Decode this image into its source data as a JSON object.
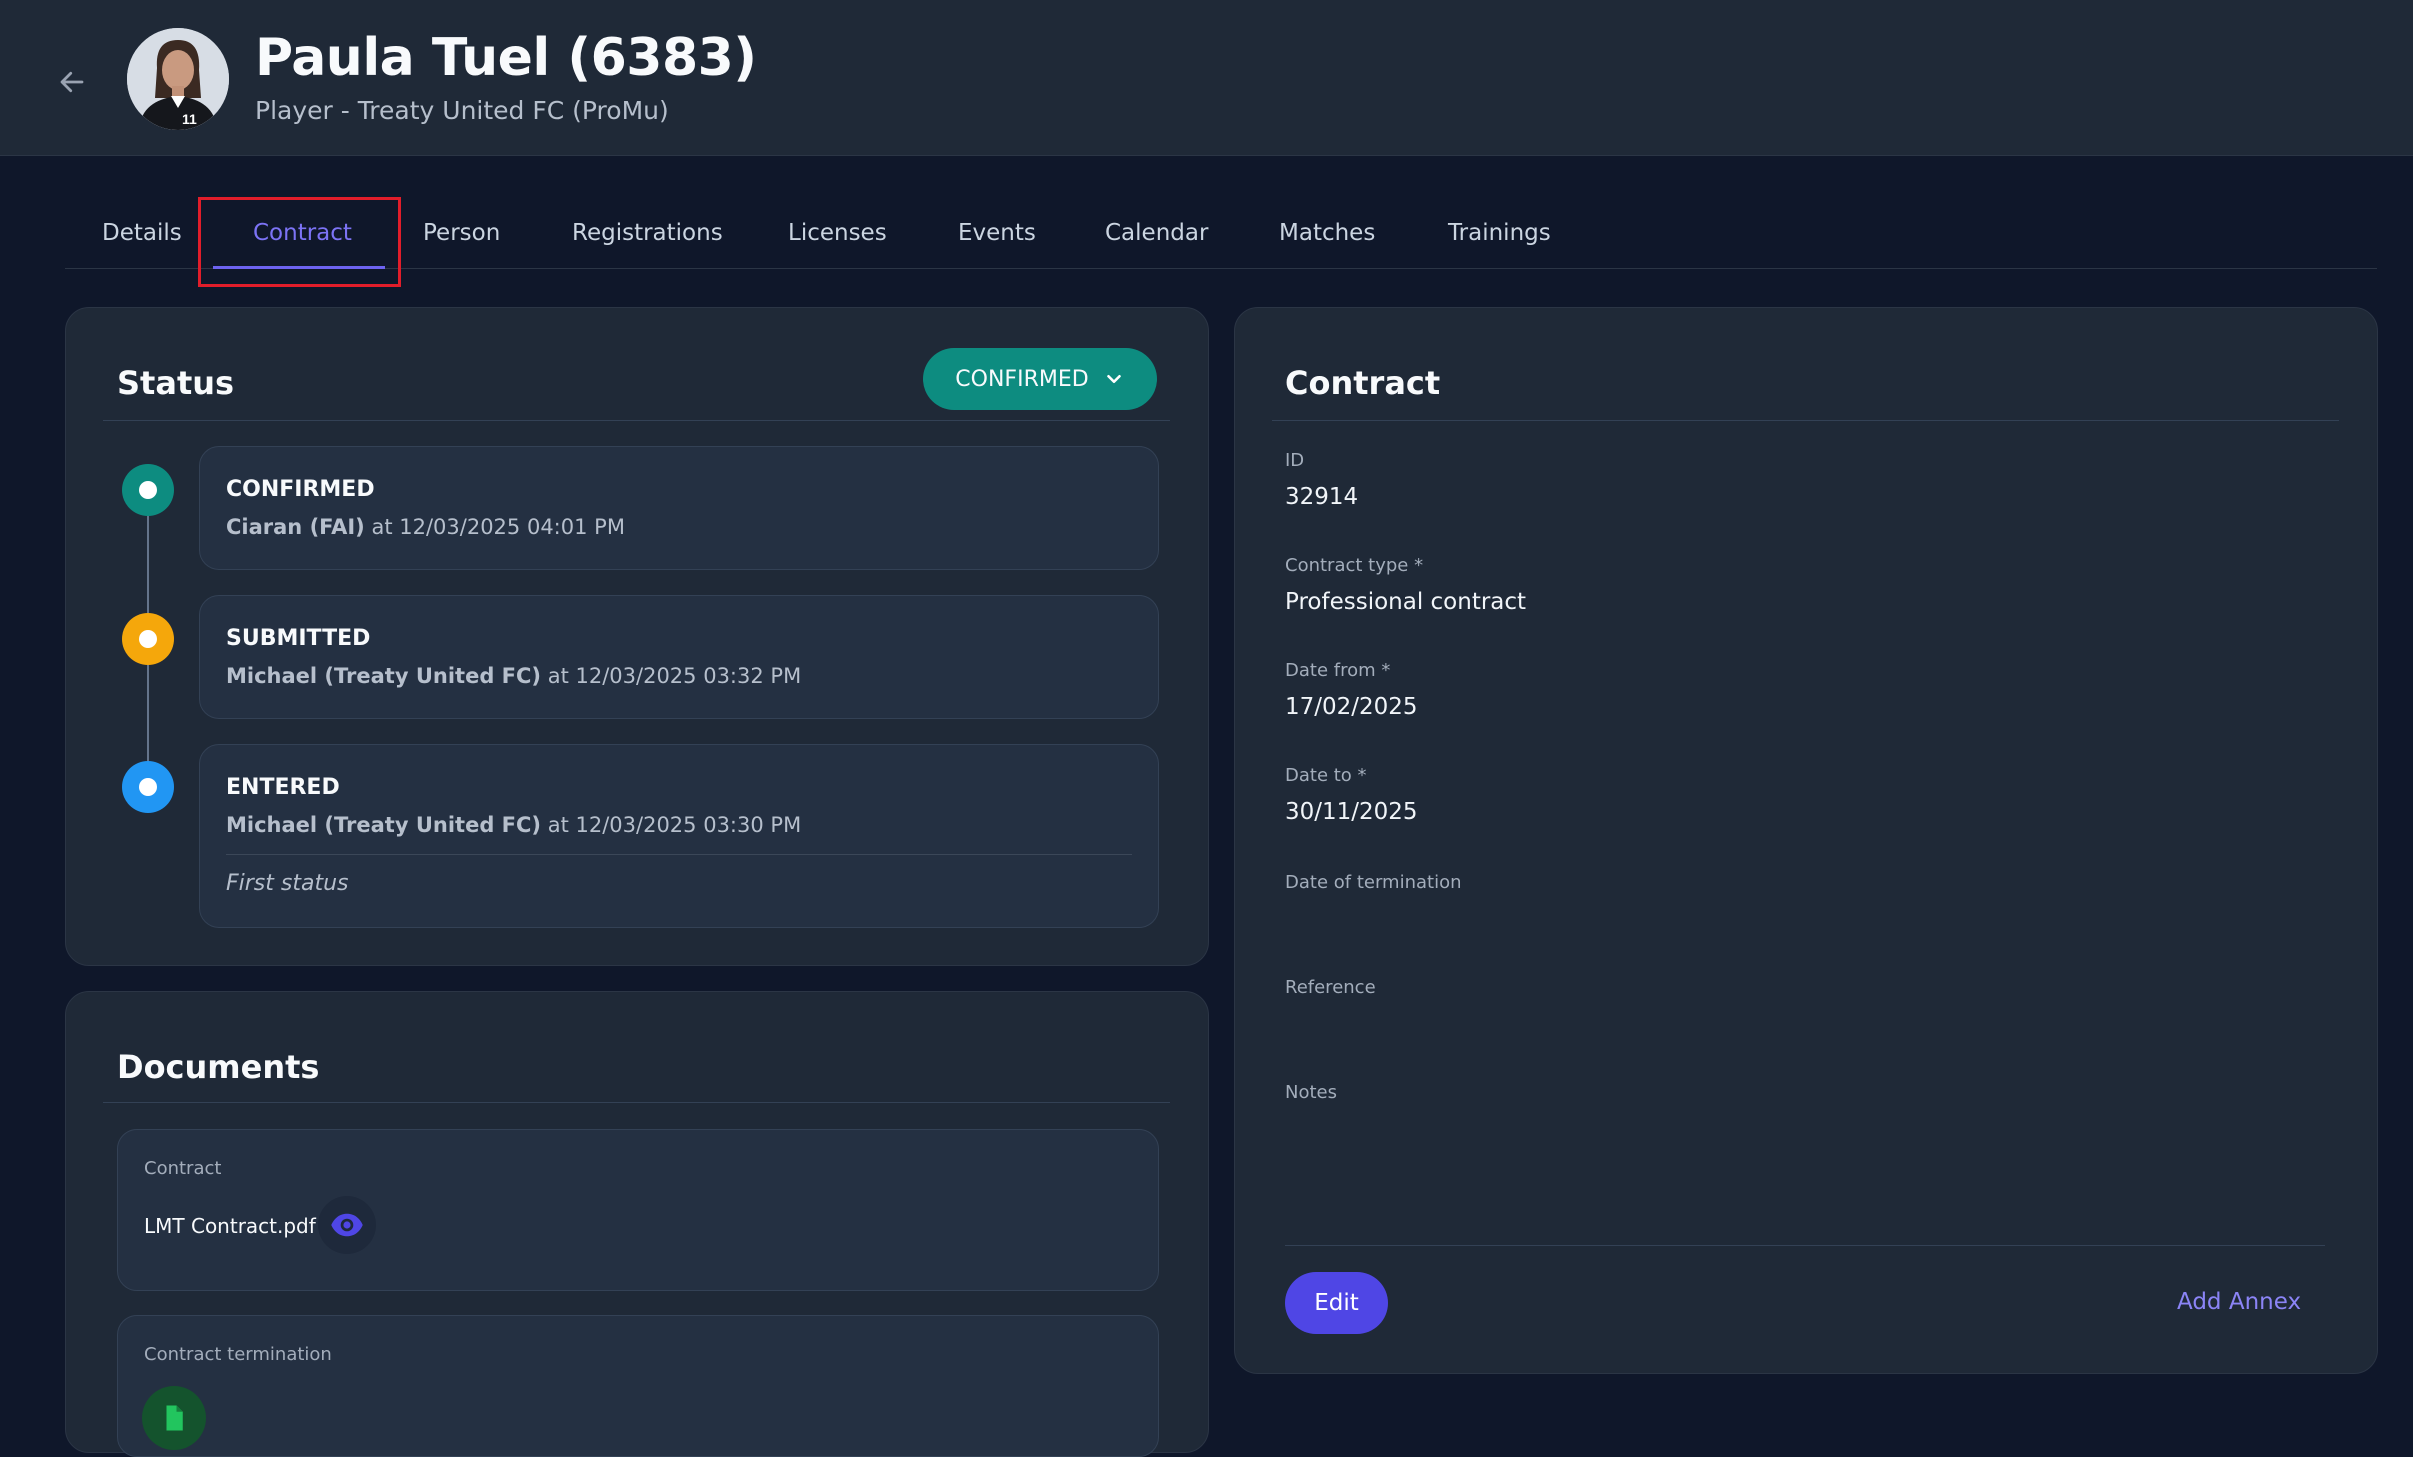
{
  "header": {
    "title": "Paula Tuel (6383)",
    "subtitle": "Player - Treaty United FC (ProMu)",
    "back_icon": "arrow-left-icon"
  },
  "tabs": [
    {
      "label": "Details"
    },
    {
      "label": "Contract",
      "active": true
    },
    {
      "label": "Person"
    },
    {
      "label": "Registrations"
    },
    {
      "label": "Licenses"
    },
    {
      "label": "Events"
    },
    {
      "label": "Calendar"
    },
    {
      "label": "Matches"
    },
    {
      "label": "Trainings"
    }
  ],
  "status_card": {
    "title": "Status",
    "current_status": "CONFIRMED",
    "items": [
      {
        "name": "CONFIRMED",
        "user": "Ciaran (FAI)",
        "time": "at 12/03/2025 04:01 PM",
        "color": "#0d8c80"
      },
      {
        "name": "SUBMITTED",
        "user": "Michael (Treaty United FC)",
        "time": "at 12/03/2025 03:32 PM",
        "color": "#f5a70b"
      },
      {
        "name": "ENTERED",
        "user": "Michael (Treaty United FC)",
        "time": "at 12/03/2025 03:30 PM",
        "note": "First status",
        "color": "#2196f3"
      }
    ]
  },
  "documents_card": {
    "title": "Documents",
    "items": [
      {
        "label": "Contract",
        "file": "LMT Contract.pdf"
      },
      {
        "label": "Contract termination",
        "file": ""
      }
    ]
  },
  "contract_card": {
    "title": "Contract",
    "fields": [
      {
        "label": "ID",
        "value": "32914"
      },
      {
        "label": "Contract type *",
        "value": "Professional contract"
      },
      {
        "label": "Date from *",
        "value": "17/02/2025"
      },
      {
        "label": "Date to *",
        "value": "30/11/2025"
      },
      {
        "label": "Date of termination",
        "value": ""
      },
      {
        "label": "Reference",
        "value": ""
      },
      {
        "label": "Notes",
        "value": ""
      }
    ],
    "edit_label": "Edit",
    "add_annex_label": "Add Annex"
  },
  "colors": {
    "accent": "#4f46e5",
    "confirmed": "#0d8c80",
    "submitted": "#f5a70b",
    "entered": "#2196f3",
    "background": "#0f172a",
    "card": "#1f2937"
  }
}
